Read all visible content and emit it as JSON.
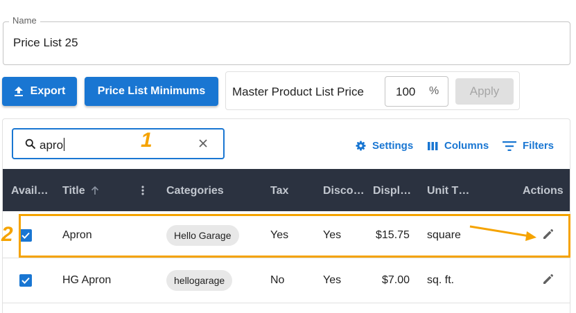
{
  "name_field": {
    "label": "Name",
    "value": "Price List 25"
  },
  "toolbar": {
    "export_label": "Export",
    "minimums_label": "Price List Minimums",
    "master_label": "Master Product List Price",
    "percent_value": "100",
    "percent_sign": "%",
    "apply_label": "Apply"
  },
  "search": {
    "value": "apro",
    "icon": "search-icon",
    "clear_icon": "close-icon"
  },
  "grid_tools": {
    "settings": "Settings",
    "columns": "Columns",
    "filters": "Filters"
  },
  "columns": [
    "Avail…",
    "Title",
    "Categories",
    "Tax",
    "Disco…",
    "Displ…",
    "Unit T…",
    "Actions"
  ],
  "rows": [
    {
      "available": true,
      "title": "Apron",
      "category": "Hello Garage",
      "tax": "Yes",
      "discount": "Yes",
      "display_price": "$15.75",
      "unit_type": "square"
    },
    {
      "available": true,
      "title": "HG Apron",
      "category": "hellogarage",
      "tax": "No",
      "discount": "Yes",
      "display_price": "$7.00",
      "unit_type": "sq. ft."
    }
  ],
  "annotations": {
    "step1": "1",
    "step2": "2"
  },
  "colors": {
    "primary": "#1976d2",
    "header_bg": "#2b3240",
    "annotation": "#f5a300",
    "disabled": "#e0e0e0"
  }
}
